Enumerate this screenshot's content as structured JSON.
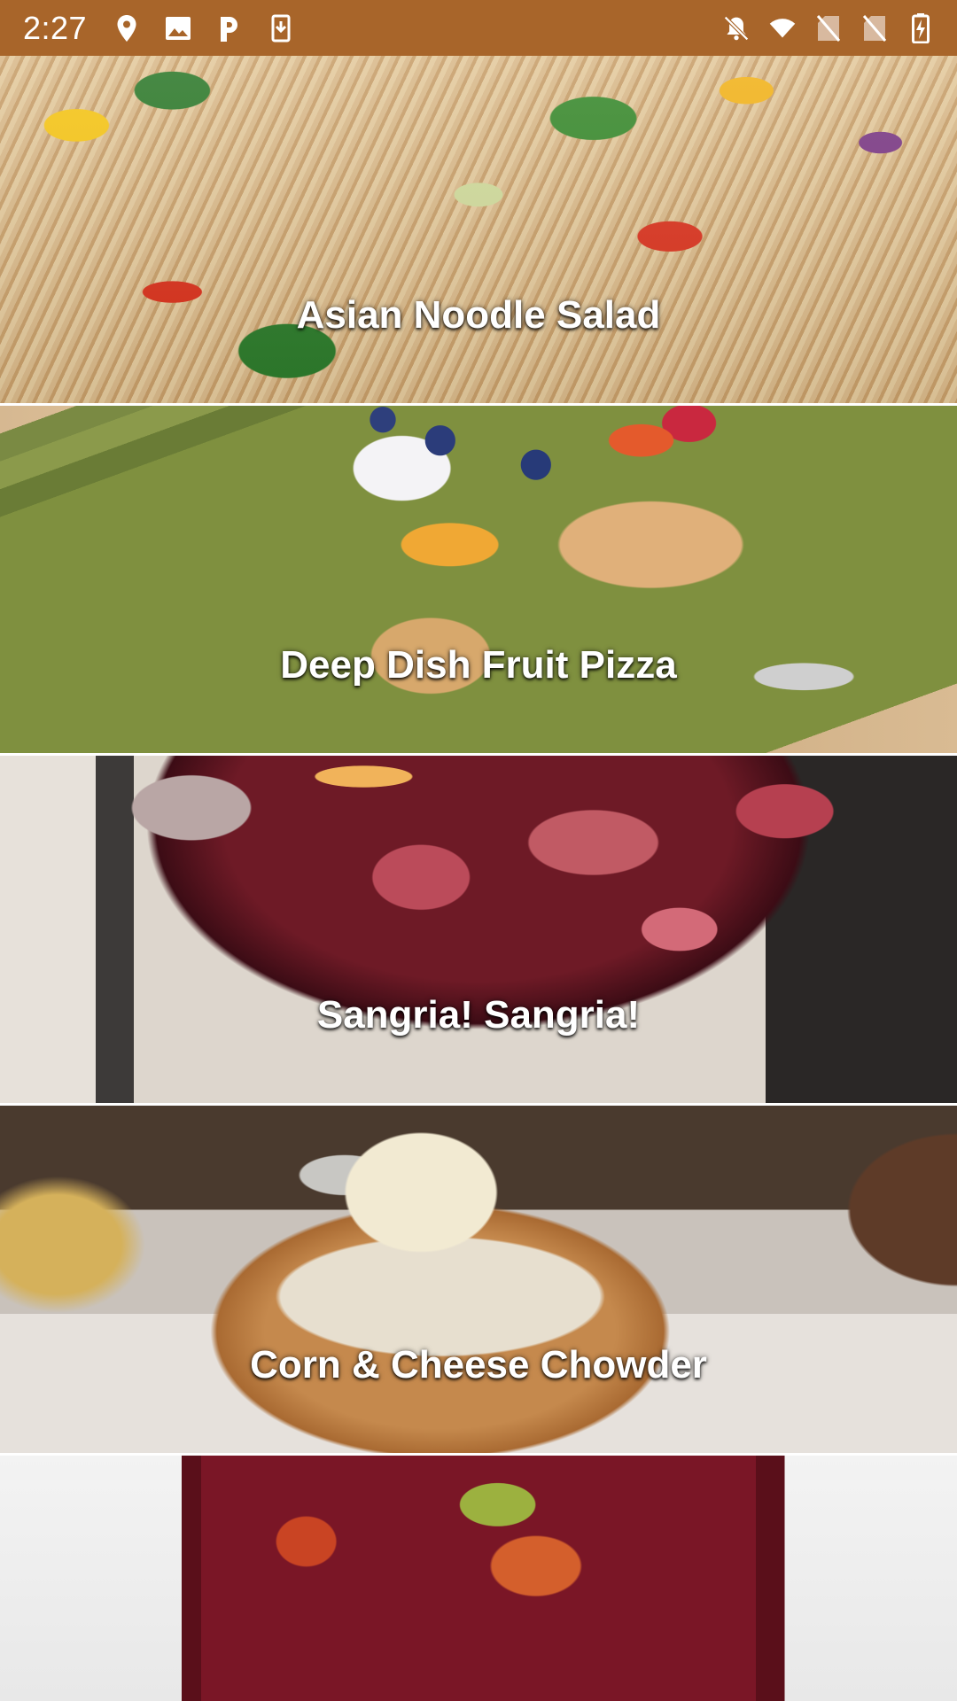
{
  "status_bar": {
    "time": "2:27",
    "background_color": "#a8652a",
    "left_icons": [
      "location-icon",
      "image-icon",
      "parking-icon",
      "download-icon"
    ],
    "right_icons": [
      "notifications-off-icon",
      "wifi-icon",
      "no-sim-icon",
      "no-sim-icon",
      "battery-charging-icon"
    ]
  },
  "recipes": [
    {
      "title": "Asian Noodle Salad",
      "image": "noodle-salad-photo"
    },
    {
      "title": "Deep Dish Fruit Pizza",
      "image": "fruit-pizza-photo"
    },
    {
      "title": "Sangria! Sangria!",
      "image": "sangria-bowl-photo"
    },
    {
      "title": "Corn & Cheese Chowder",
      "image": "chowder-bread-bowl-photo"
    },
    {
      "title": "",
      "image": "sangria-glass-photo"
    }
  ]
}
